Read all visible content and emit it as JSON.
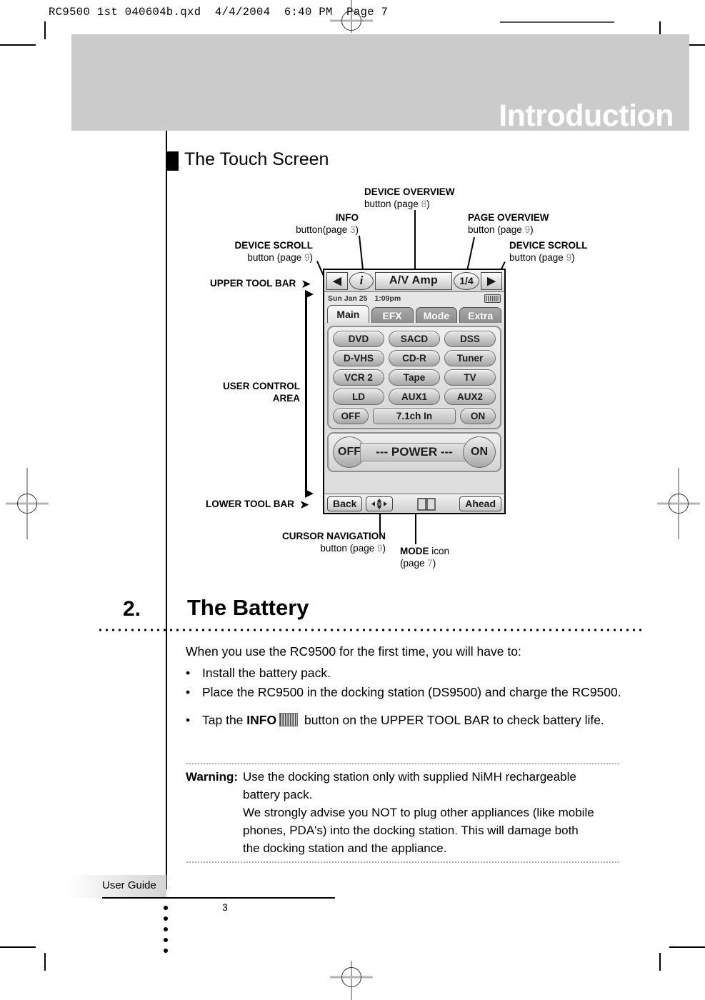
{
  "print_header": "RC9500 1st 040604b.qxd  4/4/2004  6:40 PM  Page 7",
  "band": {
    "title": "Introduction"
  },
  "section_touch": {
    "heading": "The Touch Screen"
  },
  "annotations": {
    "device_overview": {
      "name": "DEVICE OVERVIEW",
      "sub_pre": "button (page ",
      "page": "8",
      "sub_post": ")"
    },
    "info": {
      "name": "INFO",
      "sub_pre": "button(page ",
      "page": "3",
      "sub_post": ")"
    },
    "page_overview": {
      "name": "PAGE OVERVIEW",
      "sub_pre": "button (page ",
      "page": "9",
      "sub_post": ")"
    },
    "device_scroll_left": {
      "name": "DEVICE SCROLL",
      "sub_pre": "button (page ",
      "page": "9",
      "sub_post": ")"
    },
    "device_scroll_right": {
      "name": "DEVICE SCROLL",
      "sub_pre": "button (page ",
      "page": "9",
      "sub_post": ")"
    },
    "upper_tool_bar": {
      "name": "UPPER TOOL BAR",
      "arrow": "➤"
    },
    "user_control_area": {
      "line1": "USER CONTROL",
      "line2": "AREA"
    },
    "lower_tool_bar": {
      "name": "LOWER TOOL BAR",
      "arrow": "➤"
    },
    "cursor_navigation": {
      "name": "CURSOR NAVIGATION",
      "sub_pre": "button (page ",
      "page": "9",
      "sub_post": ")"
    },
    "mode_icon": {
      "name": "MODE",
      "suffix": " icon",
      "sub_pre": "(page ",
      "page": "7",
      "sub_post": ")"
    }
  },
  "device": {
    "upper_toolbar": {
      "scroll_left_icon": "◀",
      "info_icon": "i",
      "device_name": "A/V Amp",
      "page_indicator": "1/4",
      "scroll_right_icon": "▶"
    },
    "status": {
      "date": "Sun Jan 25",
      "time": "1:09pm"
    },
    "tabs": [
      {
        "label": "Main",
        "active": true
      },
      {
        "label": "EFX",
        "active": false
      },
      {
        "label": "Mode",
        "active": false
      },
      {
        "label": "Extra",
        "active": false
      }
    ],
    "button_rows": [
      [
        "DVD",
        "SACD",
        "DSS"
      ],
      [
        "D-VHS",
        "CD-R",
        "Tuner"
      ],
      [
        "VCR 2",
        "Tape",
        "TV"
      ],
      [
        "LD",
        "AUX1",
        "AUX2"
      ]
    ],
    "channel_row": {
      "off": "OFF",
      "label": "7.1ch In",
      "on": "ON"
    },
    "power_row": {
      "off": "OFF",
      "label": "--- POWER ---",
      "on": "ON"
    },
    "lower_toolbar": {
      "back": "Back",
      "ahead": "Ahead"
    }
  },
  "section_battery": {
    "number": "2.",
    "title": "The Battery",
    "intro": "When you use the RC9500 for the first time, you will have to:",
    "bullet_char": "•",
    "bullets": [
      {
        "text": "Install the battery pack."
      },
      {
        "text": "Place the RC9500 in the docking station (DS9500) and charge the RC9500."
      },
      {
        "pre": "Tap the ",
        "bold": "INFO",
        "post": " button on the UPPER TOOL BAR to check battery life."
      }
    ]
  },
  "warning": {
    "label": "Warning:",
    "lines": [
      "Use the docking station only with supplied NiMH rechargeable",
      "battery pack.",
      "We strongly advise you NOT to plug other appliances (like mobile",
      "phones, PDA's) into the docking station. This will damage both",
      "the docking station and the appliance."
    ]
  },
  "footer": {
    "user_guide": "User Guide",
    "page_number": "3"
  }
}
